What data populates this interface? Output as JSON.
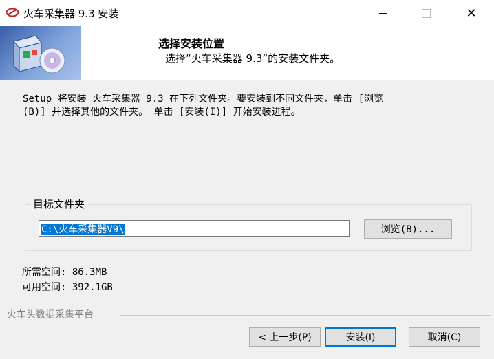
{
  "window": {
    "title": "火车采集器 9.3 安装",
    "close_glyph": "✕"
  },
  "header": {
    "title": "选择安装位置",
    "subtitle": "选择“火车采集器 9.3”的安装文件夹。"
  },
  "content": {
    "description": "Setup 将安装 火车采集器 9.3 在下列文件夹。要安装到不同文件夹，单击 [浏览\n(B)] 并选择其他的文件夹。 单击 [安装(I)] 开始安装进程。",
    "target_group_label": "目标文件夹",
    "target_path": "C:\\火车采集器V9\\",
    "browse_label": "浏览(B)...",
    "space_required": "所需空间: 86.3MB",
    "space_available": "可用空间: 392.1GB"
  },
  "footer": {
    "branding": "火车头数据采集平台",
    "back_label": "< 上一步(P)",
    "install_label": "安装(I)",
    "cancel_label": "取消(C)"
  },
  "colors": {
    "accent": "#0078d7",
    "content_bg": "#f0f0f0"
  }
}
